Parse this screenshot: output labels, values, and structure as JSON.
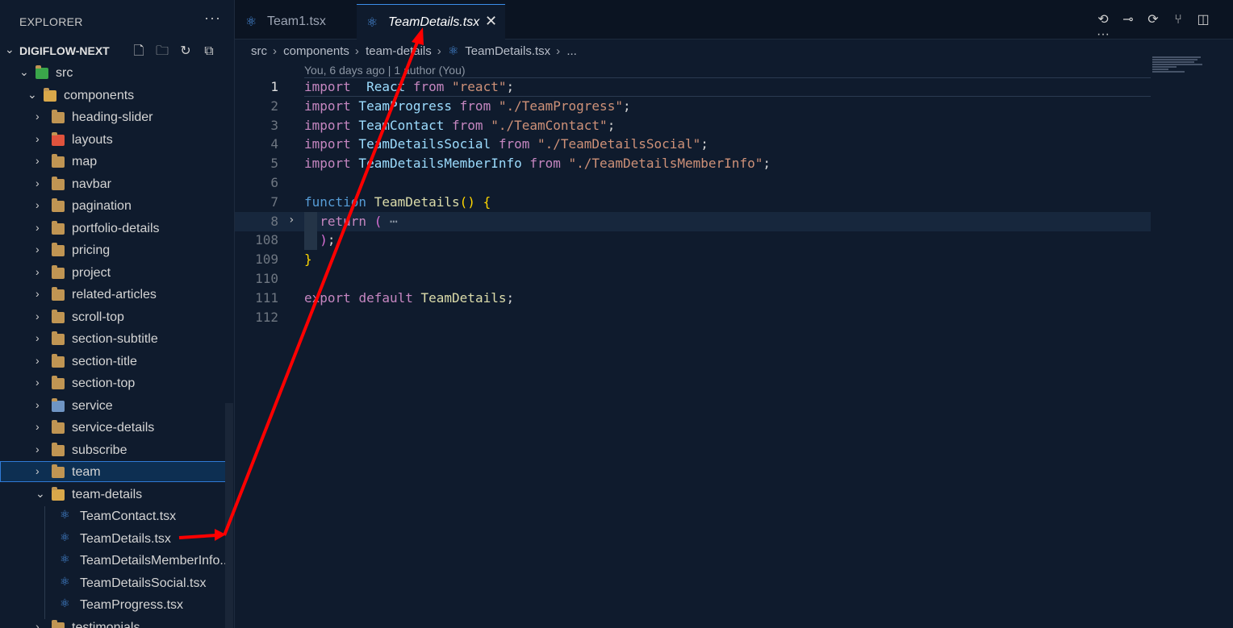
{
  "sidebar": {
    "title": "EXPLORER",
    "more_label": "···",
    "project": {
      "chevron": "⌄",
      "name": "DIGIFLOW-NEXT",
      "actions": [
        {
          "name": "new-file-icon",
          "glyph": "🗋"
        },
        {
          "name": "new-folder-icon",
          "glyph": "🗀"
        },
        {
          "name": "refresh-icon",
          "glyph": "↻"
        },
        {
          "name": "collapse-all-icon",
          "glyph": "⧉"
        }
      ]
    },
    "tree": [
      {
        "label": "src",
        "type": "folder-open-special",
        "depth": 0,
        "chevron": "⌄"
      },
      {
        "label": "components",
        "type": "folder-open",
        "depth": 1,
        "chevron": "⌄"
      },
      {
        "label": "heading-slider",
        "type": "folder",
        "depth": 2,
        "chevron": "›"
      },
      {
        "label": "layouts",
        "type": "folder-layout",
        "depth": 2,
        "chevron": "›"
      },
      {
        "label": "map",
        "type": "folder",
        "depth": 2,
        "chevron": "›"
      },
      {
        "label": "navbar",
        "type": "folder",
        "depth": 2,
        "chevron": "›"
      },
      {
        "label": "pagination",
        "type": "folder",
        "depth": 2,
        "chevron": "›"
      },
      {
        "label": "portfolio-details",
        "type": "folder",
        "depth": 2,
        "chevron": "›"
      },
      {
        "label": "pricing",
        "type": "folder",
        "depth": 2,
        "chevron": "›"
      },
      {
        "label": "project",
        "type": "folder",
        "depth": 2,
        "chevron": "›"
      },
      {
        "label": "related-articles",
        "type": "folder",
        "depth": 2,
        "chevron": "›"
      },
      {
        "label": "scroll-top",
        "type": "folder",
        "depth": 2,
        "chevron": "›"
      },
      {
        "label": "section-subtitle",
        "type": "folder",
        "depth": 2,
        "chevron": "›"
      },
      {
        "label": "section-title",
        "type": "folder",
        "depth": 2,
        "chevron": "›"
      },
      {
        "label": "section-top",
        "type": "folder",
        "depth": 2,
        "chevron": "›"
      },
      {
        "label": "service",
        "type": "folder-service",
        "depth": 2,
        "chevron": "›"
      },
      {
        "label": "service-details",
        "type": "folder",
        "depth": 2,
        "chevron": "›"
      },
      {
        "label": "subscribe",
        "type": "folder",
        "depth": 2,
        "chevron": "›"
      },
      {
        "label": "team",
        "type": "folder",
        "depth": 2,
        "chevron": "›",
        "selected": true
      },
      {
        "label": "team-details",
        "type": "folder-open",
        "depth": 2,
        "chevron": "⌄"
      },
      {
        "label": "TeamContact.tsx",
        "type": "react",
        "depth": 3
      },
      {
        "label": "TeamDetails.tsx",
        "type": "react",
        "depth": 3
      },
      {
        "label": "TeamDetailsMemberInfo....",
        "type": "react",
        "depth": 3
      },
      {
        "label": "TeamDetailsSocial.tsx",
        "type": "react",
        "depth": 3
      },
      {
        "label": "TeamProgress.tsx",
        "type": "react",
        "depth": 3
      },
      {
        "label": "testimonials",
        "type": "folder",
        "depth": 2,
        "chevron": "›"
      }
    ]
  },
  "tabs": [
    {
      "label": "Team1.tsx",
      "active": false
    },
    {
      "label": "TeamDetails.tsx",
      "active": true,
      "close": "✕"
    }
  ],
  "tab_actions": [
    {
      "name": "go-back-icon",
      "glyph": "⟲"
    },
    {
      "name": "timeline-icon",
      "glyph": "⊸"
    },
    {
      "name": "go-forward-icon",
      "glyph": "⟳"
    },
    {
      "name": "source-control-icon",
      "glyph": "⑂"
    },
    {
      "name": "split-editor-icon",
      "glyph": "◫"
    },
    {
      "name": "more-actions-icon",
      "glyph": "···"
    }
  ],
  "breadcrumb": {
    "items": [
      "src",
      "components",
      "team-details",
      "TeamDetails.tsx",
      "..."
    ],
    "separator": "›"
  },
  "codelens": "You, 6 days ago | 1 author (You)",
  "editor": {
    "lines": [
      {
        "n": "1",
        "tokens": [
          [
            "kw",
            "import"
          ],
          [
            "",
            "  "
          ],
          [
            "id",
            "React"
          ],
          [
            "",
            ""
          ],
          [
            "kw",
            " from "
          ],
          [
            "str",
            "\"react\""
          ],
          [
            "",
            ";"
          ]
        ],
        "active": true
      },
      {
        "n": "2",
        "tokens": [
          [
            "kw",
            "import"
          ],
          [
            "id",
            " TeamProgress"
          ],
          [
            "kw",
            " from "
          ],
          [
            "str",
            "\"./TeamProgress\""
          ],
          [
            "",
            ";"
          ]
        ]
      },
      {
        "n": "3",
        "tokens": [
          [
            "kw",
            "import"
          ],
          [
            "id",
            " TeamContact"
          ],
          [
            "kw",
            " from "
          ],
          [
            "str",
            "\"./TeamContact\""
          ],
          [
            "",
            ";"
          ]
        ]
      },
      {
        "n": "4",
        "tokens": [
          [
            "kw",
            "import"
          ],
          [
            "id",
            " TeamDetailsSocial"
          ],
          [
            "kw",
            " from "
          ],
          [
            "str",
            "\"./TeamDetailsSocial\""
          ],
          [
            "",
            ";"
          ]
        ]
      },
      {
        "n": "5",
        "tokens": [
          [
            "kw",
            "import"
          ],
          [
            "id",
            " TeamDetailsMemberInfo"
          ],
          [
            "kw",
            " from "
          ],
          [
            "str",
            "\"./TeamDetailsMemberInfo\""
          ],
          [
            "",
            ";"
          ]
        ]
      },
      {
        "n": "6",
        "tokens": []
      },
      {
        "n": "7",
        "tokens": [
          [
            "kwb",
            "function"
          ],
          [
            "fn",
            " TeamDetails"
          ],
          [
            "br1",
            "()"
          ],
          [
            "",
            " "
          ],
          [
            "br1",
            "{"
          ]
        ]
      },
      {
        "n": "8",
        "tokens": [
          [
            "",
            "  "
          ],
          [
            "kw",
            "return"
          ],
          [
            "",
            " "
          ],
          [
            "br2",
            "("
          ],
          [
            "",
            " "
          ],
          [
            "fold-dots",
            "⋯"
          ]
        ],
        "folded": true,
        "current": true
      },
      {
        "n": "108",
        "tokens": [
          [
            "",
            "  "
          ],
          [
            "br2",
            ")"
          ],
          [
            "",
            ";"
          ]
        ]
      },
      {
        "n": "109",
        "tokens": [
          [
            "br1",
            "}"
          ]
        ]
      },
      {
        "n": "110",
        "tokens": []
      },
      {
        "n": "111",
        "tokens": [
          [
            "kw",
            "export"
          ],
          [
            "",
            " "
          ],
          [
            "kw",
            "default"
          ],
          [
            "fn",
            " TeamDetails"
          ],
          [
            "",
            ";"
          ]
        ]
      },
      {
        "n": "112",
        "tokens": []
      }
    ]
  },
  "colors": {
    "background": "#0f1b2d",
    "tab_bar": "#0b1422",
    "accent": "#3b8eea",
    "annotation_arrow": "#ff0000",
    "folder": "#c09553",
    "react": "#4a90e2"
  }
}
